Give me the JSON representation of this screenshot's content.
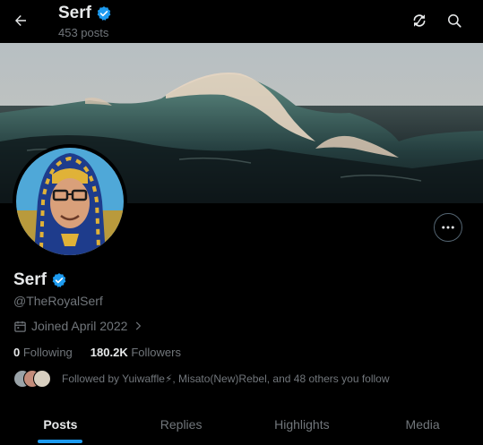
{
  "header": {
    "title": "Serf",
    "post_count": "453 posts"
  },
  "profile": {
    "name": "Serf",
    "handle": "@TheRoyalSerf",
    "joined": "Joined April 2022",
    "verified": true,
    "following_count": "0",
    "following_label": "Following",
    "followers_count": "180.2K",
    "followers_label": "Followers",
    "followed_by": "Followed by Yuiwaffle⚡, Misato(New)Rebel, and 48 others you follow"
  },
  "tabs": [
    {
      "label": "Posts",
      "active": true
    },
    {
      "label": "Replies",
      "active": false
    },
    {
      "label": "Highlights",
      "active": false
    },
    {
      "label": "Media",
      "active": false
    }
  ],
  "colors": {
    "accent": "#1d9bf0",
    "verified_badge": "#1d9bf0",
    "background": "#000000",
    "secondary_text": "#71767b"
  },
  "icons": {
    "back": "arrow-left-icon",
    "refresh": "refresh-icon",
    "search": "search-icon",
    "more": "more-horizontal-icon",
    "calendar": "calendar-icon",
    "chevron": "chevron-right-icon",
    "verified": "verified-badge-icon"
  }
}
